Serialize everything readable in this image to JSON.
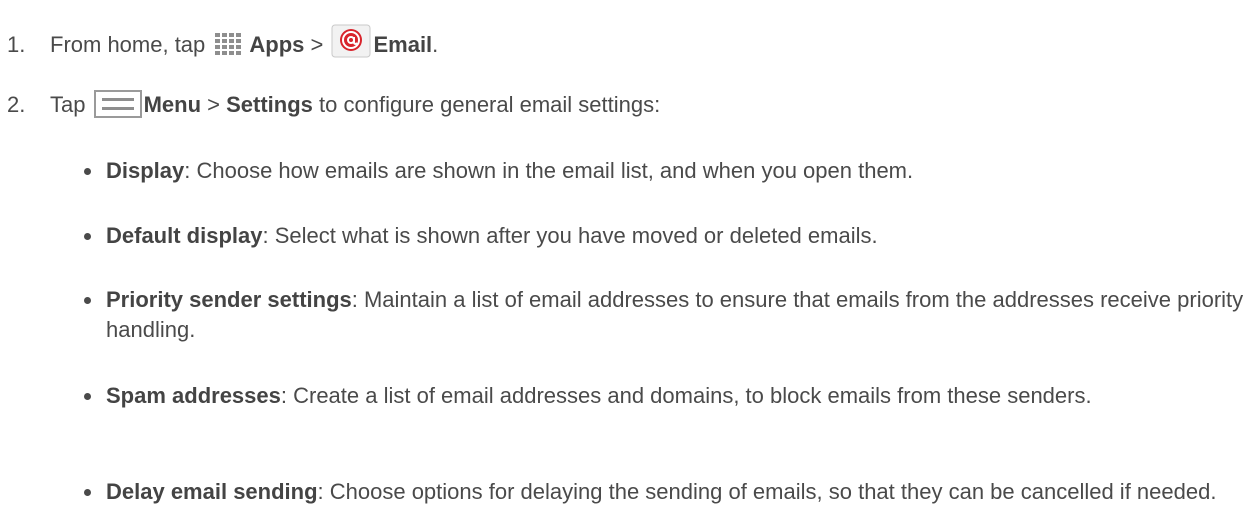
{
  "steps": [
    {
      "number": "1.",
      "text_before": "From home, tap ",
      "icon1": "apps-grid-icon",
      "label1": "Apps",
      "separator": " > ",
      "icon2": "email-icon",
      "label2": "Email",
      "text_after": "."
    },
    {
      "number": "2.",
      "text_before": "Tap ",
      "icon1": "menu-icon",
      "label1": "Menu",
      "separator": " > ",
      "label2": "Settings",
      "text_after": " to configure general email settings:"
    }
  ],
  "settings": [
    {
      "term": "Display",
      "desc": ": Choose how emails are shown in the email list, and when you open them."
    },
    {
      "term": "Default display",
      "desc": ": Select what is shown after you have moved or deleted emails."
    },
    {
      "term": "Priority sender settings",
      "desc": ": Maintain a list of email addresses to ensure that emails from the addresses receive priority handling."
    },
    {
      "term": "Spam addresses",
      "desc": ": Create a list of email addresses and domains, to block emails from these senders."
    },
    {
      "term": "Delay email sending",
      "desc": ": Choose options for delaying the sending of emails, so that they can be cancelled if needed."
    }
  ],
  "colors": {
    "text": "#4a4a4a",
    "email_icon_red": "#d8242c"
  }
}
